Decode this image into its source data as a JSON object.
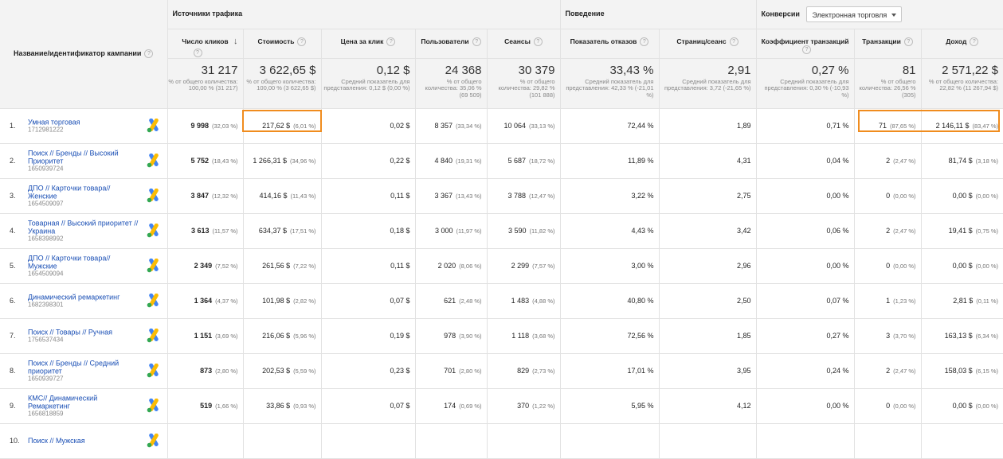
{
  "header": {
    "name_col": "Название/идентификатор кампании",
    "groups": {
      "traffic": "Источники трафика",
      "behavior": "Поведение",
      "conversions": "Конверсии",
      "conversions_select": "Электронная торговля"
    },
    "metrics": {
      "clicks": "Число кликов",
      "cost": "Стоимость",
      "cpc": "Цена за клик",
      "users": "Пользователи",
      "sessions": "Сеансы",
      "bounce": "Показатель отказов",
      "pages": "Страниц/сеанс",
      "conv_rate": "Коэффициент транзакций",
      "transactions": "Транзакции",
      "revenue": "Доход"
    }
  },
  "totals": {
    "clicks": {
      "big": "31 217",
      "small": "% от общего количества: 100,00 % (31 217)"
    },
    "cost": {
      "big": "3 622,65 $",
      "small": "% от общего количества: 100,00 % (3 622,65 $)"
    },
    "cpc": {
      "big": "0,12 $",
      "small": "Средний показатель для представления: 0,12 $ (0,00 %)"
    },
    "users": {
      "big": "24 368",
      "small": "% от общего количества: 35,06 % (69 509)"
    },
    "sessions": {
      "big": "30 379",
      "small": "% от общего количества: 29,82 % (101 888)"
    },
    "bounce": {
      "big": "33,43 %",
      "small": "Средний показатель для представления: 42,33 % (-21,01 %)"
    },
    "pages": {
      "big": "2,91",
      "small": "Средний показатель для представления: 3,72 (-21,65 %)"
    },
    "conv_rate": {
      "big": "0,27 %",
      "small": "Средний показатель для представления: 0,30 % (-10,93 %)"
    },
    "transactions": {
      "big": "81",
      "small": "% от общего количества: 26,56 % (305)"
    },
    "revenue": {
      "big": "2 571,22 $",
      "small": "% от общего количества: 22,82 % (11 267,94 $)"
    }
  },
  "rows": [
    {
      "n": "1.",
      "name": "Умная торговая",
      "id": "1712981222",
      "clicks": "9 998",
      "clicks_p": "(32,03 %)",
      "cost": "217,62 $",
      "cost_p": "(6,01 %)",
      "cpc": "0,02 $",
      "users": "8 357",
      "users_p": "(33,34 %)",
      "sessions": "10 064",
      "sessions_p": "(33,13 %)",
      "bounce": "72,44 %",
      "pages": "1,89",
      "conv": "0,71 %",
      "tr": "71",
      "tr_p": "(87,65 %)",
      "rev": "2 146,11 $",
      "rev_p": "(83,47 %)"
    },
    {
      "n": "2.",
      "name": "Поиск // Бренды // Высокий Приоритет",
      "id": "1650939724",
      "clicks": "5 752",
      "clicks_p": "(18,43 %)",
      "cost": "1 266,31 $",
      "cost_p": "(34,96 %)",
      "cpc": "0,22 $",
      "users": "4 840",
      "users_p": "(19,31 %)",
      "sessions": "5 687",
      "sessions_p": "(18,72 %)",
      "bounce": "11,89 %",
      "pages": "4,31",
      "conv": "0,04 %",
      "tr": "2",
      "tr_p": "(2,47 %)",
      "rev": "81,74 $",
      "rev_p": "(3,18 %)"
    },
    {
      "n": "3.",
      "name": "ДПО // Карточки товара// Женские",
      "id": "1654509097",
      "clicks": "3 847",
      "clicks_p": "(12,32 %)",
      "cost": "414,16 $",
      "cost_p": "(11,43 %)",
      "cpc": "0,11 $",
      "users": "3 367",
      "users_p": "(13,43 %)",
      "sessions": "3 788",
      "sessions_p": "(12,47 %)",
      "bounce": "3,22 %",
      "pages": "2,75",
      "conv": "0,00 %",
      "tr": "0",
      "tr_p": "(0,00 %)",
      "rev": "0,00 $",
      "rev_p": "(0,00 %)"
    },
    {
      "n": "4.",
      "name": "Товарная // Высокий приоритет //Украина",
      "id": "1658398992",
      "clicks": "3 613",
      "clicks_p": "(11,57 %)",
      "cost": "634,37 $",
      "cost_p": "(17,51 %)",
      "cpc": "0,18 $",
      "users": "3 000",
      "users_p": "(11,97 %)",
      "sessions": "3 590",
      "sessions_p": "(11,82 %)",
      "bounce": "4,43 %",
      "pages": "3,42",
      "conv": "0,06 %",
      "tr": "2",
      "tr_p": "(2,47 %)",
      "rev": "19,41 $",
      "rev_p": "(0,75 %)"
    },
    {
      "n": "5.",
      "name": "ДПО // Карточки товара// Мужские",
      "id": "1654509094",
      "clicks": "2 349",
      "clicks_p": "(7,52 %)",
      "cost": "261,56 $",
      "cost_p": "(7,22 %)",
      "cpc": "0,11 $",
      "users": "2 020",
      "users_p": "(8,06 %)",
      "sessions": "2 299",
      "sessions_p": "(7,57 %)",
      "bounce": "3,00 %",
      "pages": "2,96",
      "conv": "0,00 %",
      "tr": "0",
      "tr_p": "(0,00 %)",
      "rev": "0,00 $",
      "rev_p": "(0,00 %)"
    },
    {
      "n": "6.",
      "name": "Динамический ремаркетинг",
      "id": "1682398301",
      "clicks": "1 364",
      "clicks_p": "(4,37 %)",
      "cost": "101,98 $",
      "cost_p": "(2,82 %)",
      "cpc": "0,07 $",
      "users": "621",
      "users_p": "(2,48 %)",
      "sessions": "1 483",
      "sessions_p": "(4,88 %)",
      "bounce": "40,80 %",
      "pages": "2,50",
      "conv": "0,07 %",
      "tr": "1",
      "tr_p": "(1,23 %)",
      "rev": "2,81 $",
      "rev_p": "(0,11 %)"
    },
    {
      "n": "7.",
      "name": "Поиск // Товары // Ручная",
      "id": "1756537434",
      "clicks": "1 151",
      "clicks_p": "(3,69 %)",
      "cost": "216,06 $",
      "cost_p": "(5,96 %)",
      "cpc": "0,19 $",
      "users": "978",
      "users_p": "(3,90 %)",
      "sessions": "1 118",
      "sessions_p": "(3,68 %)",
      "bounce": "72,56 %",
      "pages": "1,85",
      "conv": "0,27 %",
      "tr": "3",
      "tr_p": "(3,70 %)",
      "rev": "163,13 $",
      "rev_p": "(6,34 %)"
    },
    {
      "n": "8.",
      "name": "Поиск // Бренды // Средний приоритет",
      "id": "1650939727",
      "clicks": "873",
      "clicks_p": "(2,80 %)",
      "cost": "202,53 $",
      "cost_p": "(5,59 %)",
      "cpc": "0,23 $",
      "users": "701",
      "users_p": "(2,80 %)",
      "sessions": "829",
      "sessions_p": "(2,73 %)",
      "bounce": "17,01 %",
      "pages": "3,95",
      "conv": "0,24 %",
      "tr": "2",
      "tr_p": "(2,47 %)",
      "rev": "158,03 $",
      "rev_p": "(6,15 %)"
    },
    {
      "n": "9.",
      "name": "КМС// Динамический Ремаркетинг",
      "id": "1656818859",
      "clicks": "519",
      "clicks_p": "(1,66 %)",
      "cost": "33,86 $",
      "cost_p": "(0,93 %)",
      "cpc": "0,07 $",
      "users": "174",
      "users_p": "(0,69 %)",
      "sessions": "370",
      "sessions_p": "(1,22 %)",
      "bounce": "5,95 %",
      "pages": "4,12",
      "conv": "0,00 %",
      "tr": "0",
      "tr_p": "(0,00 %)",
      "rev": "0,00 $",
      "rev_p": "(0,00 %)"
    },
    {
      "n": "10.",
      "name": "Поиск // Мужская",
      "id": "",
      "clicks": "",
      "clicks_p": "",
      "cost": "",
      "cost_p": "",
      "cpc": "",
      "users": "",
      "users_p": "",
      "sessions": "",
      "sessions_p": "",
      "bounce": "",
      "pages": "",
      "conv": "",
      "tr": "",
      "tr_p": "",
      "rev": "",
      "rev_p": ""
    }
  ],
  "icons": {
    "ads": "google-ads-icon",
    "help": "help-icon",
    "sort": "sort-down-icon"
  },
  "colors": {
    "highlight": "#f08c1e",
    "link": "#1a4fb5",
    "header_bg": "#f3f3f3"
  }
}
